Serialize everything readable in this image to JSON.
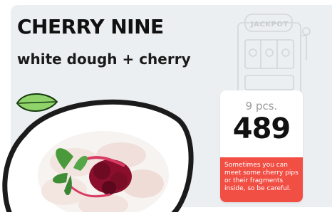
{
  "product": {
    "title": "CHERRY NINE",
    "subtitle": "white dough + cherry"
  },
  "decoration": {
    "slot_label": "JACKPOT"
  },
  "price_card": {
    "quantity": "9 pcs.",
    "price": "489",
    "warning": "Sometimes you can meet some cherry pips or their fragments inside, so be careful."
  },
  "colors": {
    "background": "#eceff1",
    "accent": "#f14e44",
    "text": "#111111"
  }
}
